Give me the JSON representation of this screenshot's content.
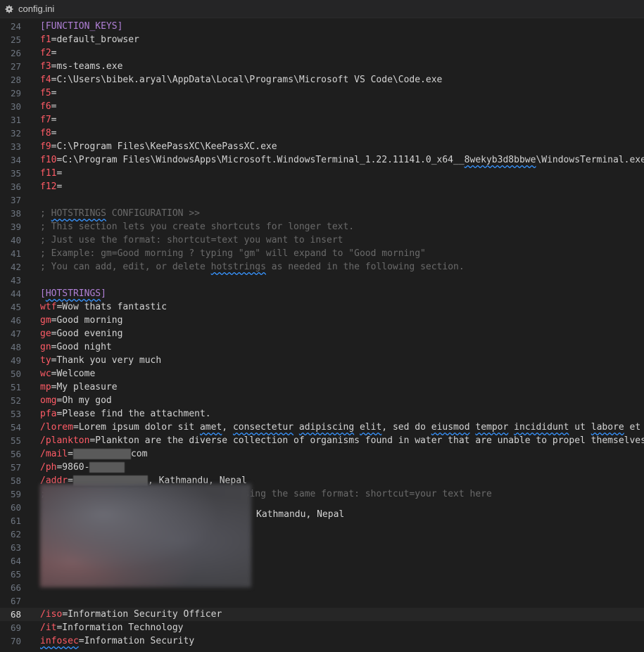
{
  "tab": {
    "title": "config.ini",
    "icon": "gear-icon"
  },
  "current_line": 68,
  "lines": [
    {
      "n": "24",
      "parts": [
        {
          "t": "[",
          "c": "sec"
        },
        {
          "t": "FUNCTION_KEYS",
          "c": "sec"
        },
        {
          "t": "]",
          "c": "sec"
        }
      ]
    },
    {
      "n": "25",
      "parts": [
        {
          "t": "f1",
          "c": "k"
        },
        {
          "t": "=default_browser",
          "c": ""
        }
      ]
    },
    {
      "n": "26",
      "parts": [
        {
          "t": "f2",
          "c": "k"
        },
        {
          "t": "=",
          "c": ""
        }
      ]
    },
    {
      "n": "27",
      "parts": [
        {
          "t": "f3",
          "c": "k"
        },
        {
          "t": "=ms-teams.exe",
          "c": ""
        }
      ]
    },
    {
      "n": "28",
      "parts": [
        {
          "t": "f4",
          "c": "k"
        },
        {
          "t": "=C:\\Users\\bibek.aryal\\AppData\\Local\\Programs\\Microsoft VS Code\\Code.exe",
          "c": ""
        }
      ]
    },
    {
      "n": "29",
      "parts": [
        {
          "t": "f5",
          "c": "k"
        },
        {
          "t": "=",
          "c": ""
        }
      ]
    },
    {
      "n": "30",
      "parts": [
        {
          "t": "f6",
          "c": "k"
        },
        {
          "t": "=",
          "c": ""
        }
      ]
    },
    {
      "n": "31",
      "parts": [
        {
          "t": "f7",
          "c": "k"
        },
        {
          "t": "=",
          "c": ""
        }
      ]
    },
    {
      "n": "32",
      "parts": [
        {
          "t": "f8",
          "c": "k"
        },
        {
          "t": "=",
          "c": ""
        }
      ]
    },
    {
      "n": "33",
      "parts": [
        {
          "t": "f9",
          "c": "k"
        },
        {
          "t": "=C:\\Program Files\\KeePassXC\\KeePassXC.exe",
          "c": ""
        }
      ]
    },
    {
      "n": "34",
      "parts": [
        {
          "t": "f10",
          "c": "k"
        },
        {
          "t": "=C:\\Program Files\\WindowsApps\\Microsoft.WindowsTerminal_1.22.11141.0_x64__",
          "c": ""
        },
        {
          "t": "8wekyb3d8bbwe",
          "c": "wv"
        },
        {
          "t": "\\WindowsTerminal.exe",
          "c": ""
        }
      ]
    },
    {
      "n": "35",
      "parts": [
        {
          "t": "f11",
          "c": "k"
        },
        {
          "t": "=",
          "c": ""
        }
      ]
    },
    {
      "n": "36",
      "parts": [
        {
          "t": "f12",
          "c": "k"
        },
        {
          "t": "=",
          "c": ""
        }
      ]
    },
    {
      "n": "37",
      "parts": []
    },
    {
      "n": "38",
      "parts": [
        {
          "t": "; ",
          "c": "cmt"
        },
        {
          "t": "HOTSTRINGS",
          "c": "cmt wv"
        },
        {
          "t": " CONFIGURATION >>",
          "c": "cmt"
        }
      ]
    },
    {
      "n": "39",
      "parts": [
        {
          "t": "; This section lets you create shortcuts for longer text.",
          "c": "cmt"
        }
      ]
    },
    {
      "n": "40",
      "parts": [
        {
          "t": "; Just use the format: shortcut=text you want to insert",
          "c": "cmt"
        }
      ]
    },
    {
      "n": "41",
      "parts": [
        {
          "t": "; Example: gm=Good morning ? typing \"gm\" will expand to \"Good morning\"",
          "c": "cmt"
        }
      ]
    },
    {
      "n": "42",
      "parts": [
        {
          "t": "; You can add, edit, or delete ",
          "c": "cmt"
        },
        {
          "t": "hotstrings",
          "c": "cmt wv"
        },
        {
          "t": " as needed in the following section.",
          "c": "cmt"
        }
      ]
    },
    {
      "n": "43",
      "parts": []
    },
    {
      "n": "44",
      "parts": [
        {
          "t": "[",
          "c": "sec"
        },
        {
          "t": "HOTSTRINGS",
          "c": "sec wv"
        },
        {
          "t": "]",
          "c": "sec"
        }
      ]
    },
    {
      "n": "45",
      "parts": [
        {
          "t": "wtf",
          "c": "k"
        },
        {
          "t": "=Wow thats fantastic",
          "c": ""
        }
      ]
    },
    {
      "n": "46",
      "parts": [
        {
          "t": "gm",
          "c": "k"
        },
        {
          "t": "=Good morning",
          "c": ""
        }
      ]
    },
    {
      "n": "47",
      "parts": [
        {
          "t": "ge",
          "c": "k"
        },
        {
          "t": "=Good evening",
          "c": ""
        }
      ]
    },
    {
      "n": "48",
      "parts": [
        {
          "t": "gn",
          "c": "k"
        },
        {
          "t": "=Good night",
          "c": ""
        }
      ]
    },
    {
      "n": "49",
      "parts": [
        {
          "t": "ty",
          "c": "k"
        },
        {
          "t": "=Thank you very much",
          "c": ""
        }
      ]
    },
    {
      "n": "50",
      "parts": [
        {
          "t": "wc",
          "c": "k"
        },
        {
          "t": "=Welcome",
          "c": ""
        }
      ]
    },
    {
      "n": "51",
      "parts": [
        {
          "t": "mp",
          "c": "k"
        },
        {
          "t": "=My pleasure",
          "c": ""
        }
      ]
    },
    {
      "n": "52",
      "parts": [
        {
          "t": "omg",
          "c": "k"
        },
        {
          "t": "=Oh my god",
          "c": ""
        }
      ]
    },
    {
      "n": "53",
      "parts": [
        {
          "t": "pfa",
          "c": "k"
        },
        {
          "t": "=Please find the attachment.",
          "c": ""
        }
      ]
    },
    {
      "n": "54",
      "parts": [
        {
          "t": "/lorem",
          "c": "k"
        },
        {
          "t": "=Lorem ipsum dolor sit ",
          "c": ""
        },
        {
          "t": "amet",
          "c": "wv"
        },
        {
          "t": ", ",
          "c": ""
        },
        {
          "t": "consectetur",
          "c": "wv"
        },
        {
          "t": " ",
          "c": ""
        },
        {
          "t": "adipiscing",
          "c": "wv"
        },
        {
          "t": " ",
          "c": ""
        },
        {
          "t": "elit",
          "c": "wv"
        },
        {
          "t": ", sed do ",
          "c": ""
        },
        {
          "t": "eiusmod",
          "c": "wv"
        },
        {
          "t": " ",
          "c": ""
        },
        {
          "t": "tempor",
          "c": "wv"
        },
        {
          "t": " ",
          "c": ""
        },
        {
          "t": "incididunt",
          "c": "wv"
        },
        {
          "t": " ut ",
          "c": ""
        },
        {
          "t": "labore",
          "c": "wv"
        },
        {
          "t": " et do",
          "c": ""
        }
      ]
    },
    {
      "n": "55",
      "parts": [
        {
          "t": "/plankton",
          "c": "k"
        },
        {
          "t": "=Plankton are the diverse collection of organisms found in water that are unable to propel themselves a",
          "c": ""
        }
      ]
    },
    {
      "n": "56",
      "parts": [
        {
          "t": "/mail",
          "c": "k"
        },
        {
          "t": "=",
          "c": ""
        },
        {
          "t": "",
          "c": "redact",
          "w": 82
        },
        {
          "t": "com",
          "c": ""
        }
      ]
    },
    {
      "n": "57",
      "parts": [
        {
          "t": "/ph",
          "c": "k"
        },
        {
          "t": "=9860-",
          "c": ""
        },
        {
          "t": "",
          "c": "redact",
          "w": 50
        }
      ]
    },
    {
      "n": "58",
      "parts": [
        {
          "t": "/addr",
          "c": "k"
        },
        {
          "t": "=",
          "c": ""
        },
        {
          "t": "",
          "c": "redact",
          "w": 106
        },
        {
          "t": ", Kathmandu, Nepal",
          "c": ""
        }
      ]
    },
    {
      "n": "59",
      "parts": [
        {
          "t": "; you may add more ",
          "c": "cmt"
        },
        {
          "t": "hotstrings",
          "c": "cmt wv"
        },
        {
          "t": " below using the same format: shortcut=your text here",
          "c": "cmt"
        }
      ]
    },
    {
      "n": "60",
      "parts": []
    },
    {
      "n": "61",
      "parts": []
    },
    {
      "n": "62",
      "parts": []
    },
    {
      "n": "63",
      "parts": []
    },
    {
      "n": "64",
      "parts": []
    },
    {
      "n": "65",
      "parts": []
    },
    {
      "n": "66",
      "parts": []
    },
    {
      "n": "67",
      "parts": []
    },
    {
      "n": "68",
      "parts": [
        {
          "t": "/iso",
          "c": "k"
        },
        {
          "t": "=Information Security Officer",
          "c": ""
        }
      ]
    },
    {
      "n": "69",
      "parts": [
        {
          "t": "/it",
          "c": "k"
        },
        {
          "t": "=Information Technology",
          "c": ""
        }
      ]
    },
    {
      "n": "70",
      "parts": [
        {
          "t": "infosec",
          "c": "k wv"
        },
        {
          "t": "=Information Security",
          "c": ""
        }
      ]
    }
  ],
  "blurred_block_text": "Kathmandu, Nepal",
  "colors": {
    "background": "#1e1e1e",
    "key": "#ff5b66",
    "section": "#b180d7",
    "comment": "#6a6a6a",
    "text": "#d4d4d4"
  }
}
